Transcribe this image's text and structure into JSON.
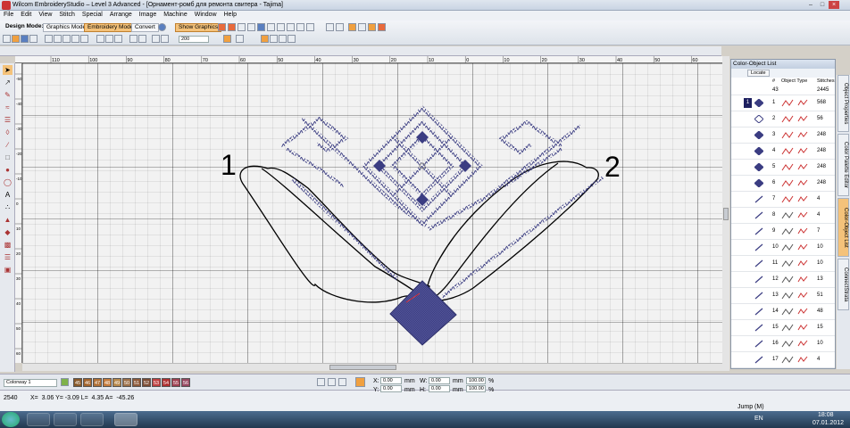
{
  "window": {
    "title": "Wilcom EmbroideryStudio – Level 3 Advanced - [Орнамент-ромб для ремонта свитера - Tajima]"
  },
  "menu": [
    "File",
    "Edit",
    "View",
    "Stitch",
    "Special",
    "Arrange",
    "Image",
    "Machine",
    "Window",
    "Help"
  ],
  "toolbar": {
    "design_mode_label": "Design Mode:",
    "graphics_mode": "Graphics Mode",
    "embroidery_mode": "Embroidery Mode",
    "convert": "Convert",
    "show_graphics": "Show Graphics",
    "zoom_value": "200"
  },
  "ruler": {
    "h_ticks": [
      "110",
      "100",
      "90",
      "80",
      "70",
      "60",
      "50",
      "40",
      "30",
      "20",
      "10",
      "0",
      "10",
      "20",
      "30",
      "40",
      "50",
      "60",
      "70"
    ],
    "v_ticks": [
      "-50",
      "-40",
      "-30",
      "-20",
      "-10",
      "0",
      "10",
      "20",
      "30",
      "40",
      "50",
      "60",
      "70"
    ],
    "corner": "mm"
  },
  "panel": {
    "title": "Color-Object List",
    "locate": "Locate",
    "cols": {
      "num": "#",
      "type": "Object Type",
      "stitches": "Stitches"
    },
    "top_row": {
      "num": "43",
      "stitches": "2445"
    },
    "rows": [
      {
        "n": "1",
        "s": "568"
      },
      {
        "n": "2",
        "s": "56"
      },
      {
        "n": "3",
        "s": "248"
      },
      {
        "n": "4",
        "s": "248"
      },
      {
        "n": "5",
        "s": "248"
      },
      {
        "n": "6",
        "s": "248"
      },
      {
        "n": "7",
        "s": "4"
      },
      {
        "n": "8",
        "s": "4"
      },
      {
        "n": "9",
        "s": "7"
      },
      {
        "n": "10",
        "s": "10"
      },
      {
        "n": "11",
        "s": "10"
      },
      {
        "n": "12",
        "s": "13"
      },
      {
        "n": "13",
        "s": "51"
      },
      {
        "n": "14",
        "s": "48"
      },
      {
        "n": "15",
        "s": "15"
      },
      {
        "n": "16",
        "s": "10"
      },
      {
        "n": "17",
        "s": "4"
      }
    ],
    "group_num": "1"
  },
  "side_tabs": [
    "Object Properties",
    "Color Palette Editor",
    "Color-Object List",
    "ConnectStrata"
  ],
  "colorbar": {
    "colorway": "Colorway 1",
    "swatches": [
      "45",
      "46",
      "47",
      "48",
      "49",
      "50",
      "51",
      "52",
      "53",
      "54",
      "55",
      "56"
    ],
    "fields": {
      "x_label": "X:",
      "x_val": "0.00",
      "y_label": "Y:",
      "y_val": "0.00",
      "w_label": "W:",
      "w_val": "0.00",
      "h_label": "H:",
      "h_val": "0.00",
      "unit": "mm",
      "pw_val": "100.00",
      "ph_val": "100.00",
      "pct": "%"
    }
  },
  "status": {
    "count": "2540",
    "coords": "X=  3.06 Y= -3.09 L=  4.35 A=  -45.26",
    "mode": "Jump (M)"
  },
  "canvas": {
    "annotation_1": "1",
    "annotation_2": "2",
    "stitch_color": "#3b3d82"
  },
  "taskbar": {
    "lang": "EN",
    "time": "18:08",
    "date": "07.01.2012"
  }
}
